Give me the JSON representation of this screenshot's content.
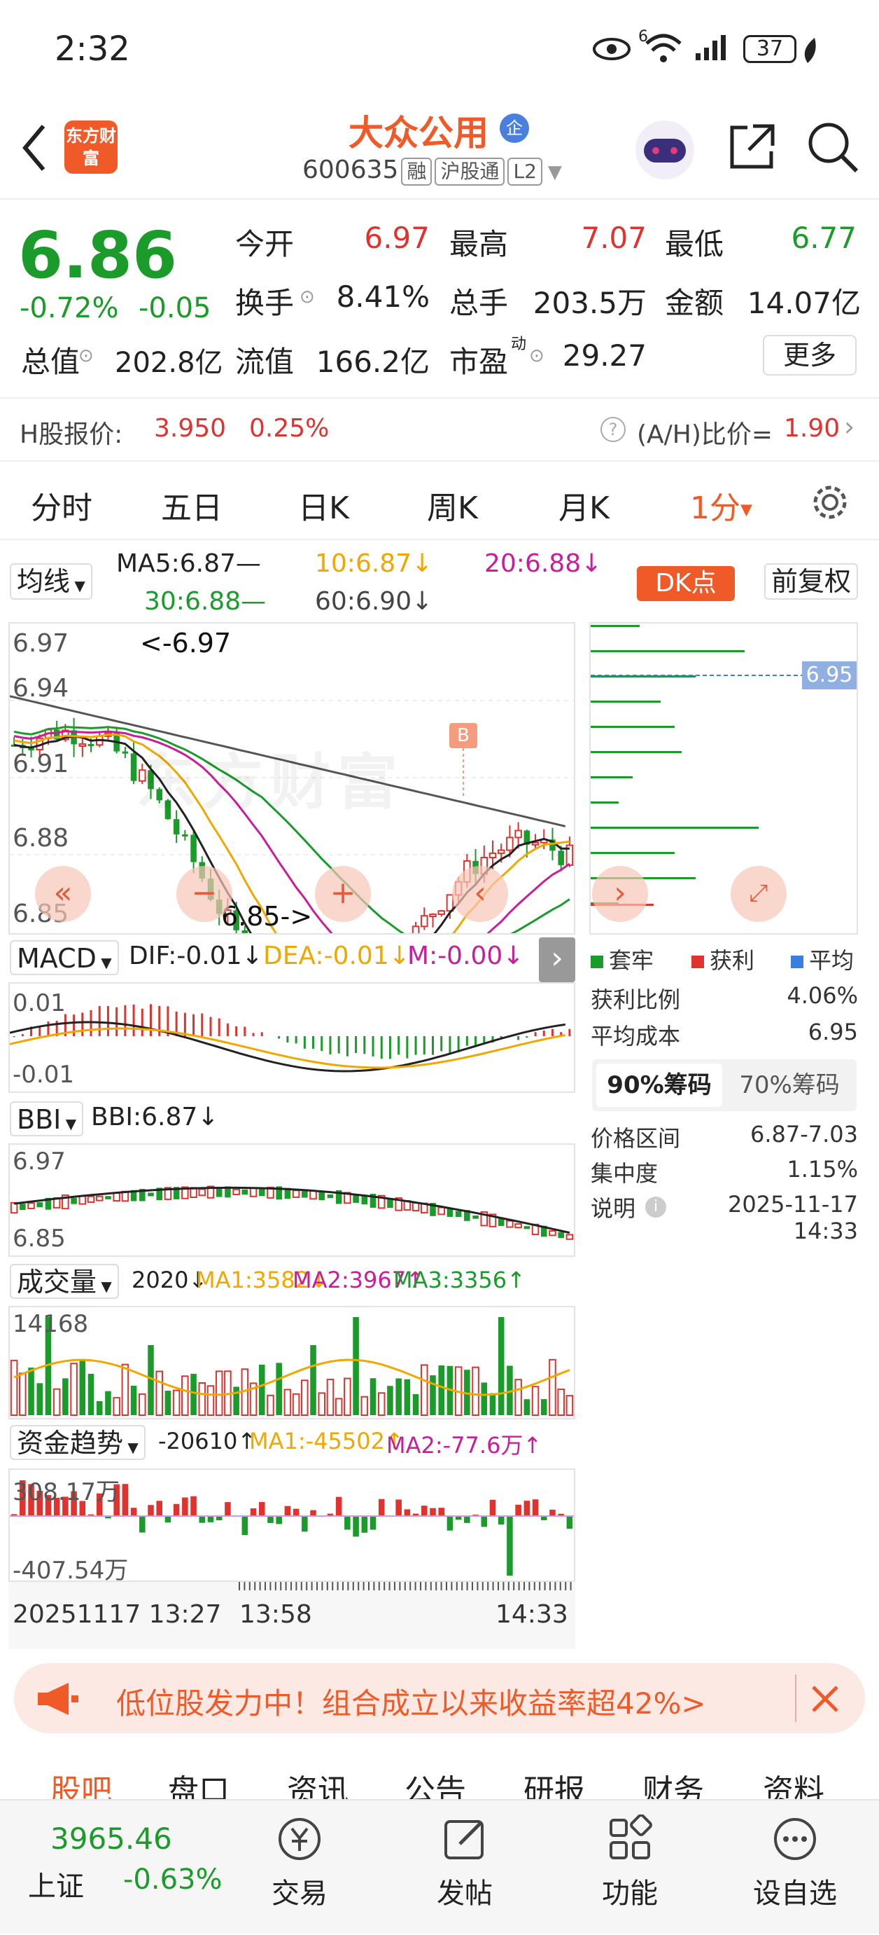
{
  "status_bar": {
    "time": "2:32",
    "network": "6",
    "battery": "37"
  },
  "header": {
    "logo_text": "东方财富",
    "title": "大众公用",
    "enterprise_badge": "企",
    "code": "600635",
    "tags": [
      "融",
      "沪股通",
      "L2"
    ]
  },
  "quote": {
    "price": "6.86",
    "change_pct": "-0.72%",
    "change": "-0.05",
    "open_label": "今开",
    "open": "6.97",
    "high_label": "最高",
    "high": "7.07",
    "low_label": "最低",
    "low": "6.77",
    "turnover_label": "换手",
    "turnover": "8.41%",
    "volume_label": "总手",
    "volume": "203.5万",
    "amount_label": "金额",
    "amount": "14.07亿",
    "mktcap_label": "总值",
    "mktcap": "202.8亿",
    "float_label": "流值",
    "float": "166.2亿",
    "pe_label": "市盈",
    "pe_sup": "动",
    "pe": "29.27",
    "more": "更多"
  },
  "h_share": {
    "label": "H股报价:",
    "price": "3.950",
    "pct": "0.25%",
    "ratio_label": "(A/H)比价=",
    "ratio": "1.90"
  },
  "tabs": [
    "分时",
    "五日",
    "日K",
    "周K",
    "月K",
    "1分"
  ],
  "ma_row": {
    "select": "均线",
    "ma5": "MA5:6.87—",
    "ma10": "10:6.87↓",
    "ma20": "20:6.88↓",
    "ma30": "30:6.88—",
    "ma60": "60:6.90↓",
    "dk": "DK点",
    "restore": "前复权"
  },
  "price_chart": {
    "y_labels": [
      "6.97",
      "6.94",
      "6.91",
      "6.88",
      "6.85"
    ],
    "high_note": "<-6.97",
    "low_note": "6.85->",
    "b_mark": "B",
    "watermark": "东方财富"
  },
  "chips": {
    "price_tag": "6.95",
    "legend": [
      "套牢",
      "获利",
      "平均"
    ],
    "profit_ratio_label": "获利比例",
    "profit_ratio": "4.06%",
    "avg_cost_label": "平均成本",
    "avg_cost": "6.95",
    "tab_90": "90%筹码",
    "tab_70": "70%筹码",
    "range_label": "价格区间",
    "range": "6.87-7.03",
    "conc_label": "集中度",
    "conc": "1.15%",
    "desc_label": "说明",
    "desc": "2025-11-17 14:33"
  },
  "macd": {
    "select": "MACD",
    "dif": "DIF:-0.01↓",
    "dea": "DEA:-0.01↓",
    "m": "M:-0.00↓",
    "y_top": "0.01",
    "y_bottom": "-0.01"
  },
  "bbi": {
    "select": "BBI",
    "value": "BBI:6.87↓",
    "y_top": "6.97",
    "y_bottom": "6.85"
  },
  "volume": {
    "select": "成交量",
    "v": "2020↓",
    "ma1": "MA1:3582↓",
    "ma2": "MA2:3967↑",
    "ma3": "MA3:3356↑",
    "y_top": "14168"
  },
  "fund": {
    "select": "资金趋势",
    "v": "-20610↑",
    "ma1": "MA1:-45502↑",
    "ma2": "MA2:-77.6万↑",
    "y_top": "308.17万",
    "y_bottom": "-407.54万"
  },
  "time_axis": [
    "20251117 13:27",
    "13:58",
    "14:33"
  ],
  "banner": "低位股发力中！组合成立以来收益率超42%>",
  "bottom_tabs": [
    "股吧",
    "盘口",
    "资讯",
    "公告",
    "研报",
    "财务",
    "资料"
  ],
  "index": {
    "value": "3965.46",
    "name": "上证",
    "pct": "-0.63%"
  },
  "nav": [
    "交易",
    "发帖",
    "功能",
    "设自选"
  ],
  "colors": {
    "up": "#e0322e",
    "down": "#1a9b2a",
    "accent": "#f05a28",
    "ma5": "#222222",
    "ma10": "#f0a800",
    "ma20": "#c81e9a",
    "ma30": "#1a9b2a",
    "ma60": "#555555"
  }
}
